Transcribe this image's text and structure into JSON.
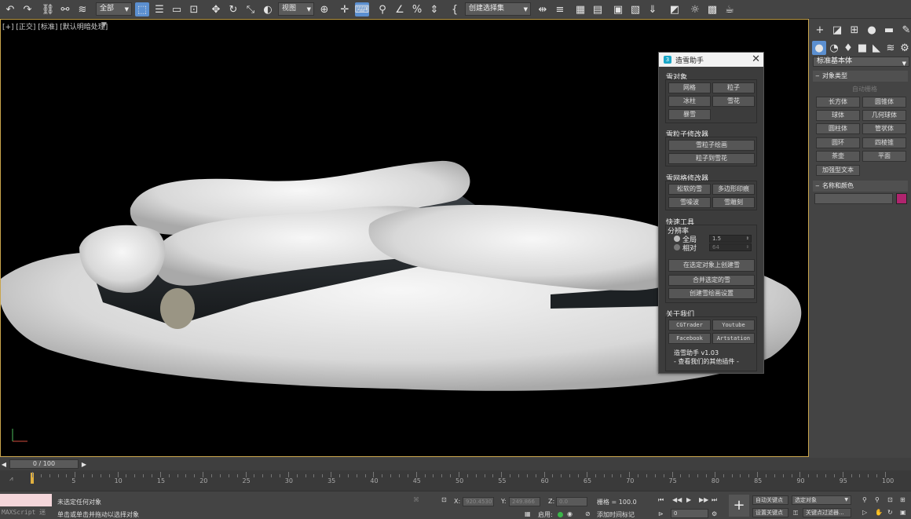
{
  "toolbar": {
    "selection_filter": "全部",
    "ref_coord": "视图",
    "named_selection": "创建选择集"
  },
  "viewport": {
    "label": "[+] [正交] [标准] [默认明暗处理]"
  },
  "dialog": {
    "title": "造雪助手",
    "snow_objects": {
      "heading": "雪对象",
      "buttons": [
        "网格",
        "粒子",
        "冰柱",
        "雪花",
        "暴雪"
      ]
    },
    "particle_modifiers": {
      "heading": "雪粒子修改器",
      "buttons": [
        "雪粒子绘画",
        "粒子到雪花"
      ]
    },
    "mesh_modifiers": {
      "heading": "雪网格修改器",
      "buttons": [
        "松软的雪",
        "多边形印痕",
        "雪噪波",
        "雪雕刻"
      ]
    },
    "quick_tools": {
      "heading": "快速工具",
      "resolution_label": "分辨率",
      "global_label": "全局",
      "global_value": "1.5",
      "relative_label": "相对",
      "relative_value": "64",
      "buttons": [
        "在选定对象上创建雪",
        "合并选定的雪",
        "创建雪绘画设置"
      ]
    },
    "about": {
      "heading": "关于我们",
      "buttons": [
        "CGTrader",
        "Youtube",
        "Facebook",
        "Artstation"
      ],
      "version": "造雪助手 v1.03",
      "more_link": "- 查看我们的其他插件 -"
    }
  },
  "command_panel": {
    "category": "标准基本体",
    "object_type_heading": "对象类型",
    "autogrid": "自动栅格",
    "primitives": [
      "长方体",
      "圆锥体",
      "球体",
      "几何球体",
      "圆柱体",
      "管状体",
      "圆环",
      "四棱锥",
      "茶壶",
      "平面",
      "加强型文本"
    ],
    "name_color_heading": "名称和颜色",
    "color": "#b0246e"
  },
  "timeline": {
    "frame_counter": "0 / 100",
    "ticks": [
      "5",
      "10",
      "15",
      "20",
      "25",
      "30",
      "35",
      "40",
      "45",
      "50",
      "55",
      "60",
      "65",
      "70",
      "75",
      "80",
      "85",
      "90",
      "95",
      "100"
    ]
  },
  "status": {
    "maxscript": "MAXScript 迷",
    "line1": "未选定任何对象",
    "line2": "单击或单击并拖动以选择对象",
    "x_label": "X:",
    "x_value": "920.4530",
    "y_label": "Y:",
    "y_value": "249.866",
    "z_label": "Z:",
    "z_value": "0.0",
    "grid": "栅格 = 100.0",
    "enable": "启用:",
    "add_time_tag": "添加时间标记",
    "auto_key": "自动关键点",
    "set_key": "设置关键点",
    "selected_object": "选定对象",
    "key_filters": "关键点过滤器...",
    "frame_input": "0"
  }
}
